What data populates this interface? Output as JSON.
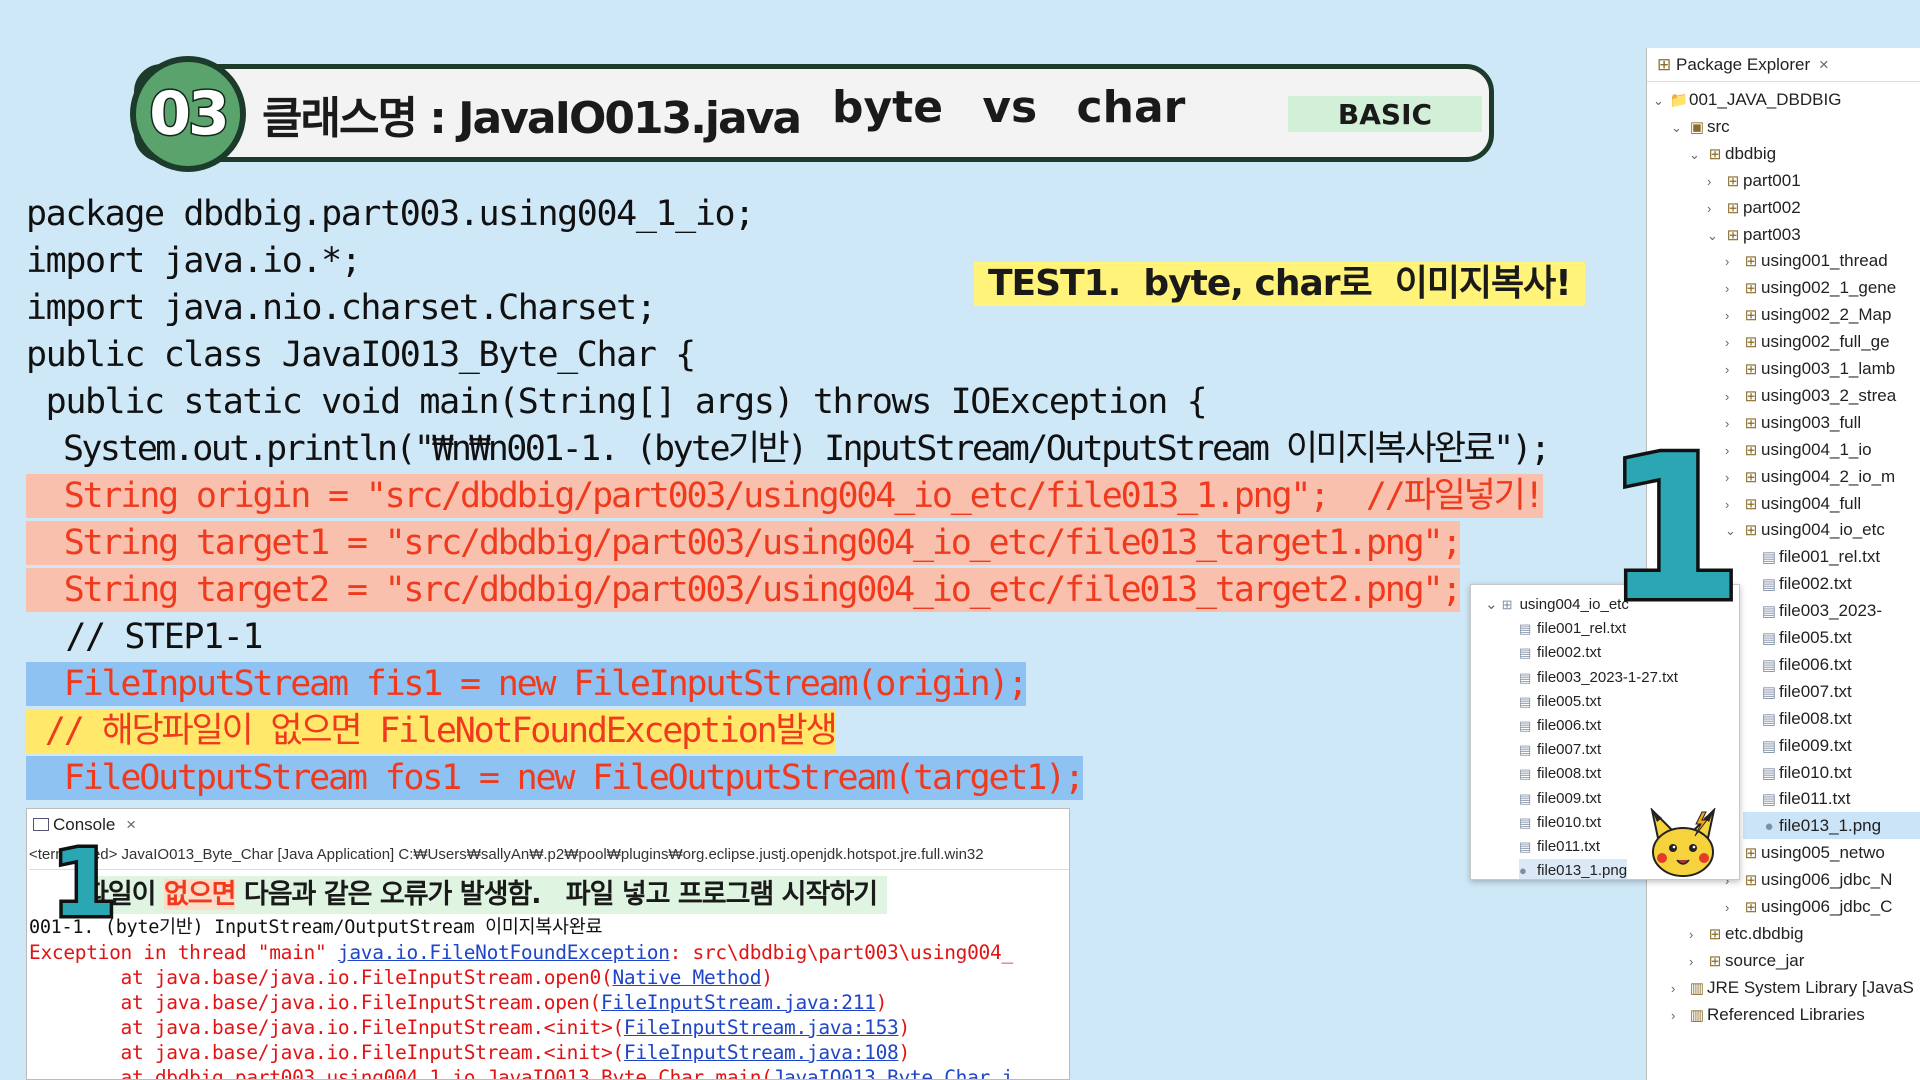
{
  "header": {
    "number": "03",
    "title": "클래스명 : JavaIO013.java",
    "subtitle": "byte   vs   char",
    "badge": "BASIC"
  },
  "code_lines": [
    "package dbdbig.part003.using004_1_io;",
    "import java.io.*;",
    "import java.nio.charset.Charset;",
    "public class JavaIO013_Byte_Char {",
    " public static void main(String[] args) throws IOException {",
    "  System.out.println(\"₩n₩n001-1. (byte기반) InputStream/OutputStream 이미지복사완료\");",
    "  String origin = \"src/dbdbig/part003/using004_io_etc/file013_1.png\";  //파일넣기!",
    "  String target1 = \"src/dbdbig/part003/using004_io_etc/file013_target1.png\";",
    "  String target2 = \"src/dbdbig/part003/using004_io_etc/file013_target2.png\";",
    "  // STEP1-1",
    "  FileInputStream fis1 = new FileInputStream(origin);",
    " // 해당파일이 없으면 FileNotFoundException발생",
    "  FileOutputStream fos1 = new FileOutputStream(target1);"
  ],
  "test_note": "TEST1.  byte, char로  이미지복사!",
  "marker_big": "1",
  "marker_small": "1",
  "console": {
    "tab_label": "Console",
    "tab_close": "×",
    "path": "<terminated> JavaIO013_Byte_Char [Java Application] C:₩Users₩sallyAn₩.p2₩pool₩plugins₩org.eclipse.justj.openjdk.hotspot.jre.full.win32",
    "note_prefix": "파일이 ",
    "note_red": "없으면",
    "note_suffix": " 다음과 같은 오류가 발생함.   파일 넣고 프로그램 시작하기",
    "output_line": "001-1. (byte기반) InputStream/OutputStream 이미지복사완료",
    "exception_prefix": "Exception in thread \"main\" ",
    "exception_link": "java.io.FileNotFoundException",
    "exception_suffix": ": src\\dbdbig\\part003\\using004_",
    "stack": [
      {
        "prefix": "        at java.base/java.io.FileInputStream.open0(",
        "link": "Native Method",
        "suffix": ")"
      },
      {
        "prefix": "        at java.base/java.io.FileInputStream.open(",
        "link": "FileInputStream.java:211",
        "suffix": ")"
      },
      {
        "prefix": "        at java.base/java.io.FileInputStream.<init>(",
        "link": "FileInputStream.java:153",
        "suffix": ")"
      },
      {
        "prefix": "        at java.base/java.io.FileInputStream.<init>(",
        "link": "FileInputStream.java:108",
        "suffix": ")"
      },
      {
        "prefix": "        at dbdbig.part003.using004_1_io.JavaIO013_Byte_Char.main(",
        "link": "JavaIO013_Byte_Char.j",
        "suffix": ""
      }
    ]
  },
  "explorer": {
    "tab_label": "Package Explorer",
    "tab_close": "×",
    "items": [
      {
        "label": "001_JAVA_DBDBIG",
        "arrow": "⌄",
        "icon": "project"
      },
      {
        "label": "src",
        "arrow": "⌄",
        "icon": "folder"
      },
      {
        "label": "dbdbig",
        "arrow": "⌄",
        "icon": "package"
      },
      {
        "label": "part001",
        "arrow": "›",
        "icon": "package"
      },
      {
        "label": "part002",
        "arrow": "›",
        "icon": "package"
      },
      {
        "label": "part003",
        "arrow": "⌄",
        "icon": "package"
      },
      {
        "label": "using001_thread",
        "arrow": "›",
        "icon": "package"
      },
      {
        "label": "using002_1_gene",
        "arrow": "›",
        "icon": "package"
      },
      {
        "label": "using002_2_Map",
        "arrow": "›",
        "icon": "package"
      },
      {
        "label": "using002_full_ge",
        "arrow": "›",
        "icon": "package"
      },
      {
        "label": "using003_1_lamb",
        "arrow": "›",
        "icon": "package"
      },
      {
        "label": "using003_2_strea",
        "arrow": "›",
        "icon": "package"
      },
      {
        "label": "using003_full",
        "arrow": "›",
        "icon": "package"
      },
      {
        "label": "using004_1_io",
        "arrow": "›",
        "icon": "package"
      },
      {
        "label": "using004_2_io_m",
        "arrow": "›",
        "icon": "package"
      },
      {
        "label": "using004_full",
        "arrow": "›",
        "icon": "package"
      },
      {
        "label": "using004_io_etc",
        "arrow": "⌄",
        "icon": "package"
      },
      {
        "label": "file001_rel.txt",
        "arrow": "",
        "icon": "file"
      },
      {
        "label": "file002.txt",
        "arrow": "",
        "icon": "file"
      },
      {
        "label": "file003_2023-",
        "arrow": "",
        "icon": "file"
      },
      {
        "label": "file005.txt",
        "arrow": "",
        "icon": "file"
      },
      {
        "label": "file006.txt",
        "arrow": "",
        "icon": "file"
      },
      {
        "label": "file007.txt",
        "arrow": "",
        "icon": "file"
      },
      {
        "label": "file008.txt",
        "arrow": "",
        "icon": "file"
      },
      {
        "label": "file009.txt",
        "arrow": "",
        "icon": "file"
      },
      {
        "label": "file010.txt",
        "arrow": "",
        "icon": "file"
      },
      {
        "label": "file011.txt",
        "arrow": "",
        "icon": "file"
      },
      {
        "label": "file013_1.png",
        "arrow": "",
        "icon": "image"
      },
      {
        "label": "using005_netwo",
        "arrow": "›",
        "icon": "package"
      },
      {
        "label": "using006_jdbc_N",
        "arrow": "›",
        "icon": "package"
      },
      {
        "label": "using006_jdbc_C",
        "arrow": "›",
        "icon": "package"
      },
      {
        "label": "etc.dbdbig",
        "arrow": "›",
        "icon": "package"
      },
      {
        "label": "source_jar",
        "arrow": "›",
        "icon": "package"
      },
      {
        "label": "JRE System Library [JavaS",
        "arrow": "›",
        "icon": "library"
      },
      {
        "label": "Referenced Libraries",
        "arrow": "›",
        "icon": "library"
      }
    ]
  },
  "inset": {
    "items": [
      {
        "label": "using004_io_etc",
        "arrow": "⌄",
        "icon": "package"
      },
      {
        "label": "file001_rel.txt",
        "arrow": "",
        "icon": "file"
      },
      {
        "label": "file002.txt",
        "arrow": "",
        "icon": "file"
      },
      {
        "label": "file003_2023-1-27.txt",
        "arrow": "",
        "icon": "file"
      },
      {
        "label": "file005.txt",
        "arrow": "",
        "icon": "file"
      },
      {
        "label": "file006.txt",
        "arrow": "",
        "icon": "file"
      },
      {
        "label": "file007.txt",
        "arrow": "",
        "icon": "file"
      },
      {
        "label": "file008.txt",
        "arrow": "",
        "icon": "file"
      },
      {
        "label": "file009.txt",
        "arrow": "",
        "icon": "file"
      },
      {
        "label": "file010.txt",
        "arrow": "",
        "icon": "file"
      },
      {
        "label": "file011.txt",
        "arrow": "",
        "icon": "file"
      },
      {
        "label": "file013_1.png",
        "arrow": "",
        "icon": "image"
      }
    ]
  },
  "colors": {
    "background": "#cfe8f8",
    "accent_green": "#5aa36d",
    "code_red": "#f03a1e",
    "highlight_salmon": "#f8c0ad",
    "highlight_blue": "#8ec2f2",
    "highlight_yellow": "#ffe86a",
    "link_blue": "#1f45c8",
    "marker_teal": "#2aa7b3"
  }
}
